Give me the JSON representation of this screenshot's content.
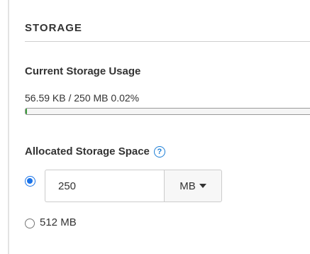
{
  "section": {
    "title": "STORAGE"
  },
  "usage": {
    "label": "Current Storage Usage",
    "text": "56.59 KB / 250 MB 0.02%",
    "percent": 0.02,
    "fill_color": "#3a9b3a"
  },
  "allocation": {
    "label": "Allocated Storage Space",
    "help_icon": "question-circle-icon",
    "custom_option": {
      "selected": true,
      "value": "250",
      "unit": "MB"
    },
    "preset_option": {
      "selected": false,
      "label": "512 MB"
    }
  },
  "colors": {
    "accent": "#1a73e8",
    "help_icon": "#1c7ed6"
  }
}
